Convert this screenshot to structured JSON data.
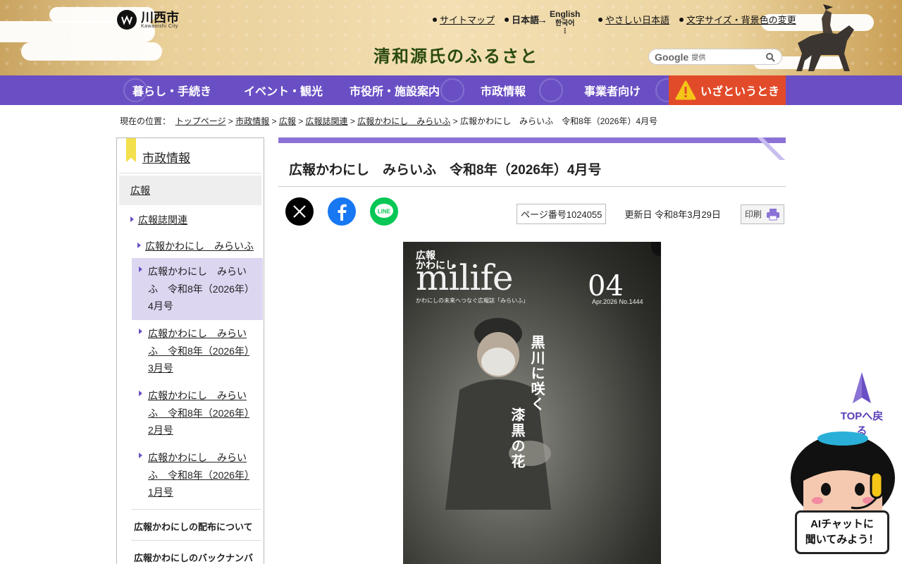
{
  "header": {
    "city_name": "川西市",
    "city_name_en": "Kawanishi City",
    "tagline": "清和源氏のふるさと",
    "utility_links": [
      "サイトマップ",
      "日本語",
      "やさしい日本語",
      "文字サイズ・背景色の変更"
    ],
    "lang_alt": [
      "English",
      "한국어",
      "⋮"
    ],
    "search_brand": "Google",
    "search_provided": "提供"
  },
  "nav": {
    "items": [
      "暮らし・手続き",
      "イベント・観光",
      "市役所・施設案内",
      "市政情報",
      "事業者向け"
    ],
    "emergency": "いざというとき"
  },
  "breadcrumb": {
    "prefix": "現在の位置：",
    "links": [
      "トップページ",
      "市政情報",
      "広報",
      "広報誌関連",
      "広報かわにし　みらいふ"
    ],
    "current": "広報かわにし　みらいふ　令和8年（2026年）4月号"
  },
  "sidebar": {
    "heading": "市政情報",
    "level1": "広報",
    "level2": "広報誌関連",
    "level3": "広報かわにし　みらいふ",
    "issues": [
      "広報かわにし　みらいふ　令和8年（2026年）4月号",
      "広報かわにし　みらいふ　令和8年（2026年）3月号",
      "広報かわにし　みらいふ　令和8年（2026年）2月号",
      "広報かわにし　みらいふ　令和8年（2026年）1月号"
    ],
    "bottom_links": [
      "広報かわにしの配布について",
      "広報かわにしのバックナンバ"
    ]
  },
  "main": {
    "title": "広報かわにし　みらいふ　令和8年（2026年）4月号",
    "page_number": "ページ番号1024055",
    "updated": "更新日 令和8年3月29日",
    "print_label": "印刷",
    "cover": {
      "top_label": "広報\nかわにし",
      "masthead": "milife",
      "subtitle": "かわにしの未来へつなぐ広報誌「みらいふ」",
      "issue": "04",
      "date_no": "Apr.2026 No.1444",
      "headline_1": "黒川に咲く",
      "headline_2": "漆黒の花"
    }
  },
  "totop": {
    "label": "TOPへ戻る"
  },
  "chat": {
    "line1": "AIチャットに",
    "line2": "聞いてみよう！"
  },
  "colors": {
    "nav": "#6a4fc4",
    "emergency": "#e24b2a",
    "accent": "#8b72d6"
  }
}
